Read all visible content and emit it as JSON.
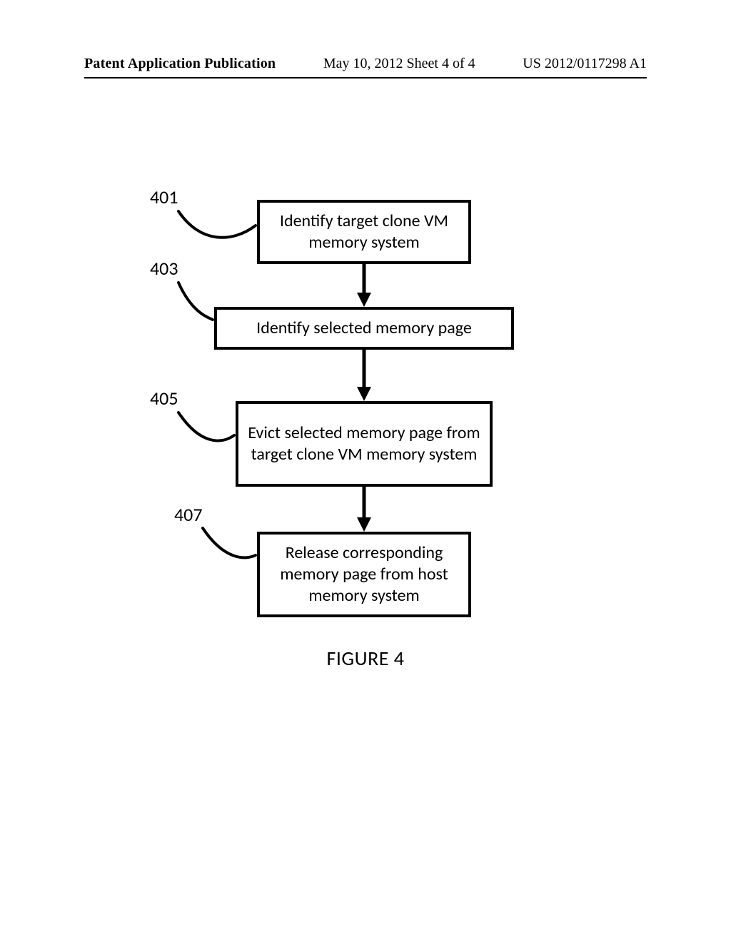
{
  "header": {
    "left": "Patent Application Publication",
    "center": "May 10, 2012  Sheet 4 of 4",
    "right": "US 2012/0117298 A1"
  },
  "figure": {
    "caption": "FIGURE 4",
    "refs": {
      "r1": "401",
      "r2": "403",
      "r3": "405",
      "r4": "407"
    },
    "steps": {
      "s1": "Identify target clone VM memory system",
      "s2": "Identify selected memory page",
      "s3": "Evict selected memory page from target clone VM memory system",
      "s4": "Release corresponding memory page from host memory system"
    }
  },
  "chart_data": {
    "type": "table",
    "title": "FIGURE 4 — flowchart steps",
    "columns": [
      "ref",
      "step_text"
    ],
    "rows": [
      [
        "401",
        "Identify target clone VM memory system"
      ],
      [
        "403",
        "Identify selected memory page"
      ],
      [
        "405",
        "Evict selected memory page from target clone VM memory system"
      ],
      [
        "407",
        "Release corresponding memory page from host memory system"
      ]
    ]
  }
}
